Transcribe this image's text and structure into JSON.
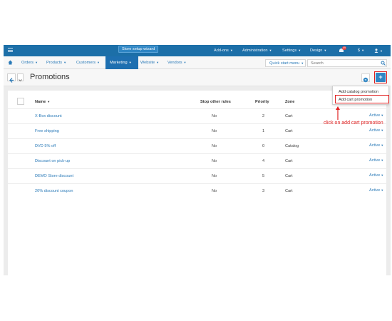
{
  "topbar": {
    "wizard_label": "Store setup wizard",
    "addons": "Add-ons",
    "administration": "Administration",
    "settings": "Settings",
    "design": "Design",
    "notifications_count": "49",
    "currency": "$",
    "user_label": ""
  },
  "nav": {
    "orders": "Orders",
    "products": "Products",
    "customers": "Customers",
    "marketing": "Marketing",
    "website": "Website",
    "vendors": "Vendors",
    "quick_start": "Quick start menu",
    "search_placeholder": "Search"
  },
  "page": {
    "title": "Promotions"
  },
  "table": {
    "headers": {
      "name": "Name",
      "stop_other_rules": "Stop other rules",
      "priority": "Priority",
      "zone": "Zone"
    },
    "rows": [
      {
        "name": "X-Box discount",
        "stop": "No",
        "priority": "2",
        "zone": "Cart",
        "status": "Active"
      },
      {
        "name": "Free shipping",
        "stop": "No",
        "priority": "1",
        "zone": "Cart",
        "status": "Active"
      },
      {
        "name": "DVD 5% off",
        "stop": "No",
        "priority": "0",
        "zone": "Catalog",
        "status": "Active"
      },
      {
        "name": "Discount on pick-up",
        "stop": "No",
        "priority": "4",
        "zone": "Cart",
        "status": "Active"
      },
      {
        "name": "DEMO Store discount",
        "stop": "No",
        "priority": "5",
        "zone": "Cart",
        "status": "Active"
      },
      {
        "name": "20% discount coupon",
        "stop": "No",
        "priority": "3",
        "zone": "Cart",
        "status": "Active"
      }
    ]
  },
  "dropdown": {
    "add_catalog": "Add catalog promotion",
    "add_cart": "Add cart promotion"
  },
  "annotation": {
    "note": "click on add cart promotion"
  },
  "colors": {
    "topbar": "#1c6fa8",
    "accent": "#2f86c4",
    "link": "#2a7ab8",
    "highlight": "#e02020"
  }
}
